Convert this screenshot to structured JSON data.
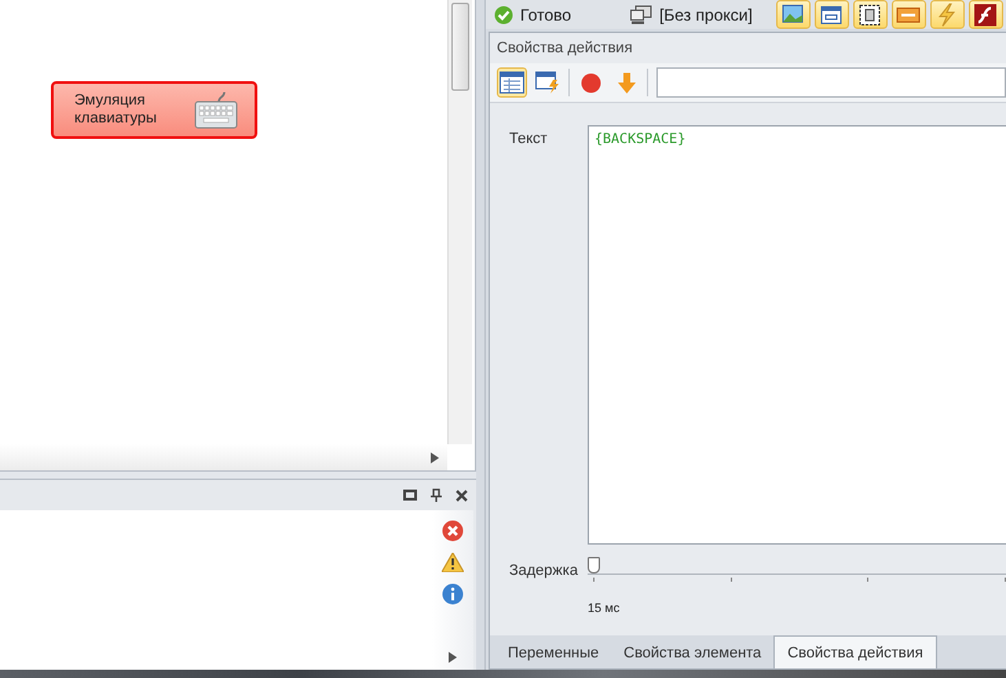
{
  "canvas": {
    "nodes": [
      {
        "label": "Эмуляция клавиатуры",
        "selected": true
      }
    ]
  },
  "status": {
    "state": "Готово",
    "proxy": "[Без прокси]"
  },
  "panel": {
    "title": "Свойства действия",
    "fields": [
      {
        "kind": "text",
        "label": "Текст",
        "value": "{BACKSPACE}"
      },
      {
        "kind": "slider",
        "label": "Задержка",
        "level": 0,
        "reading": "15 мс"
      }
    ]
  },
  "tabs": [
    {
      "label": "Переменные",
      "selected": false
    },
    {
      "label": "Свойства элемента",
      "selected": false
    },
    {
      "label": "Свойства действия",
      "selected": true
    }
  ]
}
